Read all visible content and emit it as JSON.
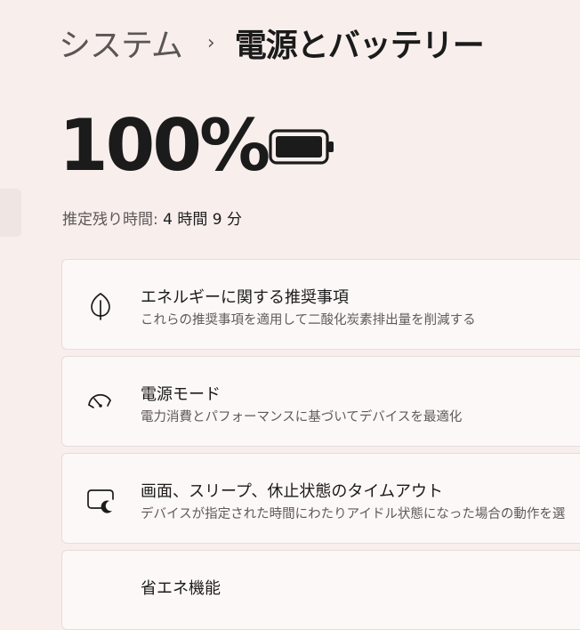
{
  "breadcrumb": {
    "parent": "システム",
    "separator": "›",
    "current": "電源とバッテリー"
  },
  "battery": {
    "percent_label": "100%",
    "level_percent": 100,
    "remaining_label": "推定残り時間:",
    "remaining_value": "4 時間 9 分"
  },
  "cards": [
    {
      "icon": "leaf-icon",
      "title": "エネルギーに関する推奨事項",
      "subtitle": "これらの推奨事項を適用して二酸化炭素排出量を削減する"
    },
    {
      "icon": "gauge-icon",
      "title": "電源モード",
      "subtitle": "電力消費とパフォーマンスに基づいてデバイスを最適化"
    },
    {
      "icon": "screen-sleep-icon",
      "title": "画面、スリープ、休止状態のタイムアウト",
      "subtitle": "デバイスが指定された時間にわたりアイドル状態になった場合の動作を選"
    },
    {
      "icon": "",
      "title": "省エネ機能",
      "subtitle": ""
    }
  ]
}
